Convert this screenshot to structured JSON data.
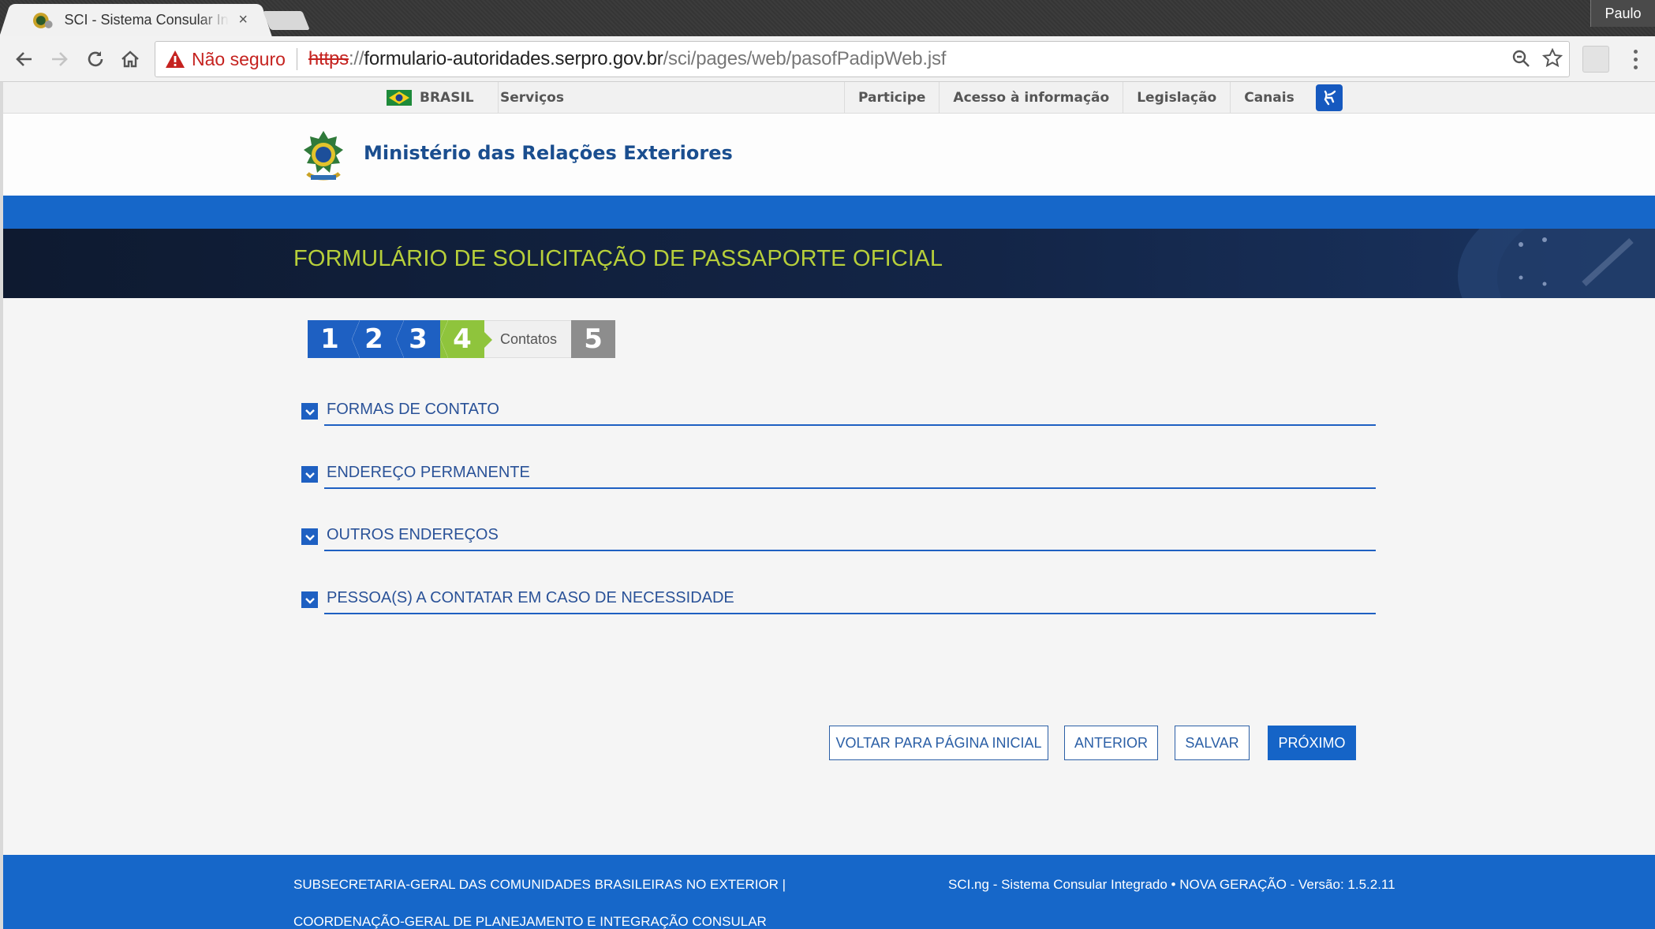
{
  "browser": {
    "tab_title": "SCI - Sistema Consular Integrado",
    "tab_close": "×",
    "profile_name": "Paulo",
    "security_label": "Não seguro",
    "url_scheme": "https",
    "url_sep": "://",
    "url_host": "formulario-autoridades.serpro.gov.br",
    "url_path": "/sci/pages/web/pasofPadipWeb.jsf"
  },
  "govbar": {
    "brasil": "BRASIL",
    "servicos": "Serviços",
    "links": [
      "Participe",
      "Acesso à informação",
      "Legislação",
      "Canais"
    ]
  },
  "header": {
    "ministry": "Ministério das Relações Exteriores",
    "form_title": "FORMULÁRIO DE SOLICITAÇÃO DE PASSAPORTE OFICIAL"
  },
  "steps": {
    "s1": "1",
    "s2": "2",
    "s3": "3",
    "s4": "4",
    "current_label": "Contatos",
    "s5": "5"
  },
  "sections": [
    "FORMAS DE CONTATO",
    "ENDEREÇO PERMANENTE",
    "OUTROS ENDEREÇOS",
    "PESSOA(S) A CONTATAR EM CASO DE NECESSIDADE"
  ],
  "buttons": {
    "home": "VOLTAR PARA PÁGINA INICIAL",
    "prev": "ANTERIOR",
    "save": "SALVAR",
    "next": "PRÓXIMO"
  },
  "footer": {
    "left": "SUBSECRETARIA-GERAL DAS COMUNIDADES BRASILEIRAS NO EXTERIOR | COORDENAÇÃO-GERAL DE PLANEJAMENTO E INTEGRAÇÃO CONSULAR",
    "right": "SCI.ng - Sistema Consular Integrado • NOVA GERAÇÃO - Versão: 1.5.2.11"
  },
  "colors": {
    "brand_blue": "#1667c9",
    "step_done": "#1e60c2",
    "step_current": "#8fc43c",
    "title_green": "#b7cf3a"
  }
}
